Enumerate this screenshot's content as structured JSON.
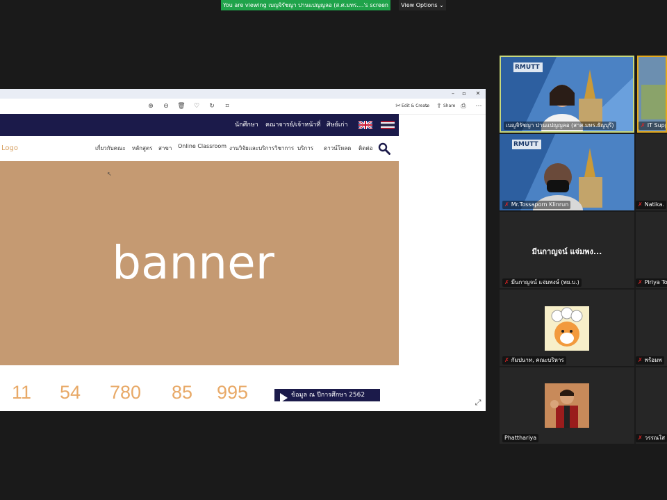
{
  "meeting": {
    "viewing_banner": "You are viewing เบญจิรัชญา ปานแปญญลอ (ส.ศ.มทร....'s screen",
    "view_options": "View Options ⌄"
  },
  "viewer": {
    "toolbar": {
      "edit_create": "Edit & Create",
      "share": "Share"
    }
  },
  "website": {
    "top_nav": [
      "นักศึกษา",
      "คณาจารย์/เจ้าหน้าที่",
      "ศิษย์เก่า"
    ],
    "logo": "Logo",
    "main_nav": [
      "เกี่ยวกับคณะ",
      "หลักสูตร",
      "สาขา",
      "Online Classroom",
      "งานวิจัยและบริการวิชาการ",
      "บริการ",
      "ดาวน์โหลด",
      "ติดต่อ"
    ],
    "banner": "banner",
    "stats": [
      "11",
      "54",
      "780",
      "85",
      "995"
    ],
    "info_button": "ข้อมูล ณ ปีการศึกษา 2562"
  },
  "participants": [
    {
      "name": "เบญจิรัชญา ปานแปญญลอ (สาส.มทร.ธัญบุรี)",
      "video": true,
      "muted": false,
      "logo": "RMUTT"
    },
    {
      "name": "IT Supp",
      "video": true,
      "muted": true
    },
    {
      "name": "Mr.Tossaporn Klinrun",
      "video": true,
      "muted": true,
      "logo": "RMUTT"
    },
    {
      "name": "Natika.",
      "video": false,
      "muted": true
    },
    {
      "name": "มีนกาญจน์ แจ่มพงษ์ (พย.บ.)",
      "big_name": "มีนกาญจน์ แจ่มพง...",
      "video": false,
      "muted": true
    },
    {
      "name": "Piriya To",
      "video": false,
      "muted": true
    },
    {
      "name": "กัมปนาท, คณะบริหาร",
      "video": false,
      "muted": true
    },
    {
      "name": "พร้อมพ",
      "video": false,
      "muted": true
    },
    {
      "name": "Phatthariya",
      "video": false,
      "muted": false
    },
    {
      "name": "วรรณใส",
      "video": false,
      "muted": true
    }
  ],
  "colors": {
    "banner_bg": "#c59a72",
    "top_nav_bg": "#1b1a4a",
    "stat_text": "#e8a967",
    "viewing_banner_bg": "#1fa34a",
    "active_speaker_border": "#c8d87c"
  }
}
